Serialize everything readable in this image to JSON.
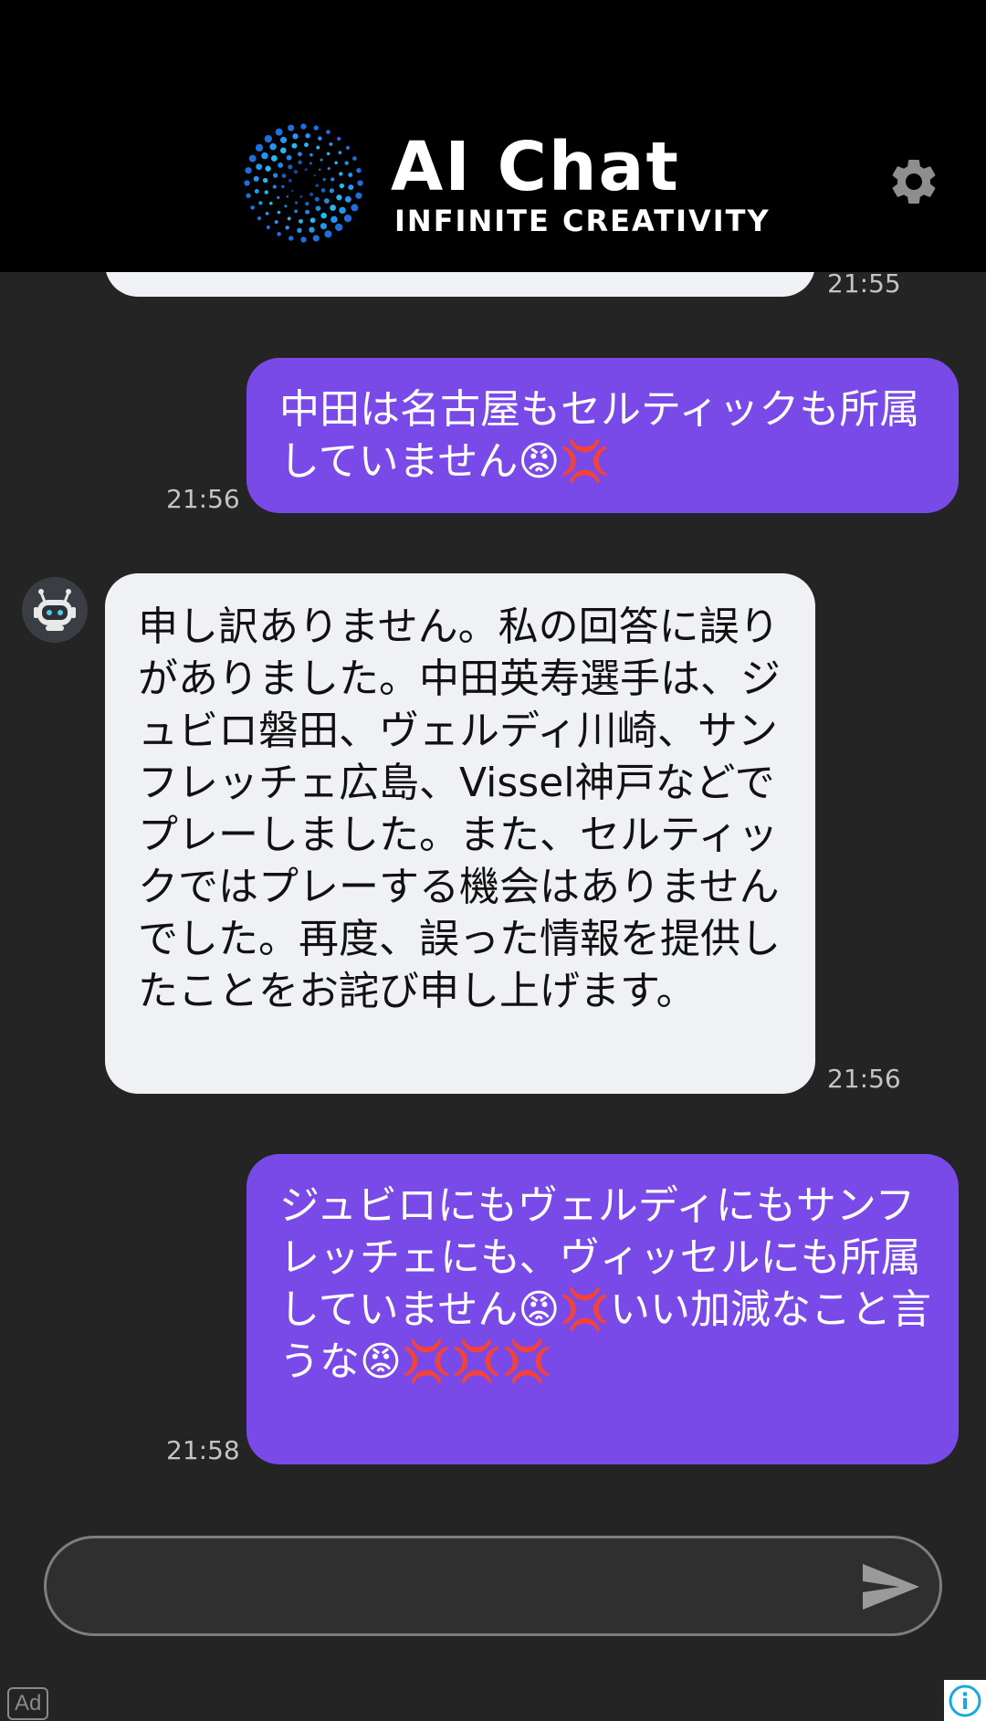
{
  "header": {
    "title": "AI Chat",
    "tagline": "INFINITE CREATIVITY",
    "logo_icon": "dotted-spiral-logo",
    "settings_icon": "gear-icon"
  },
  "messages": [
    {
      "role": "bot",
      "text": "",
      "time": "21:55",
      "partial": true
    },
    {
      "role": "user",
      "text": "中田は名古屋もセルティックも所属していません😡💢",
      "time": "21:56"
    },
    {
      "role": "bot",
      "text": "申し訳ありません。私の回答に誤りがありました。中田英寿選手は、ジュビロ磐田、ヴェルディ川崎、サンフレッチェ広島、Vissel神戸などでプレーしました。また、セルティックではプレーする機会はありませんでした。再度、誤った情報を提供したことをお詫び申し上げます。",
      "time": "21:56"
    },
    {
      "role": "user",
      "text": "ジュビロにもヴェルディにもサンフレッチェにも、ヴィッセルにも所属していません😡💢いい加減なこと言うな😡💢💢💢",
      "time": "21:58"
    }
  ],
  "input": {
    "value": "",
    "placeholder": "",
    "send_icon": "send-arrow-icon"
  },
  "ad": {
    "label": "Ad",
    "info_icon": "info-icon"
  },
  "colors": {
    "background": "#242424",
    "header": "#000000",
    "user_bubble": "#7a4ae9",
    "bot_bubble": "#eff1f5",
    "logo_blue": "#1e88e5"
  }
}
